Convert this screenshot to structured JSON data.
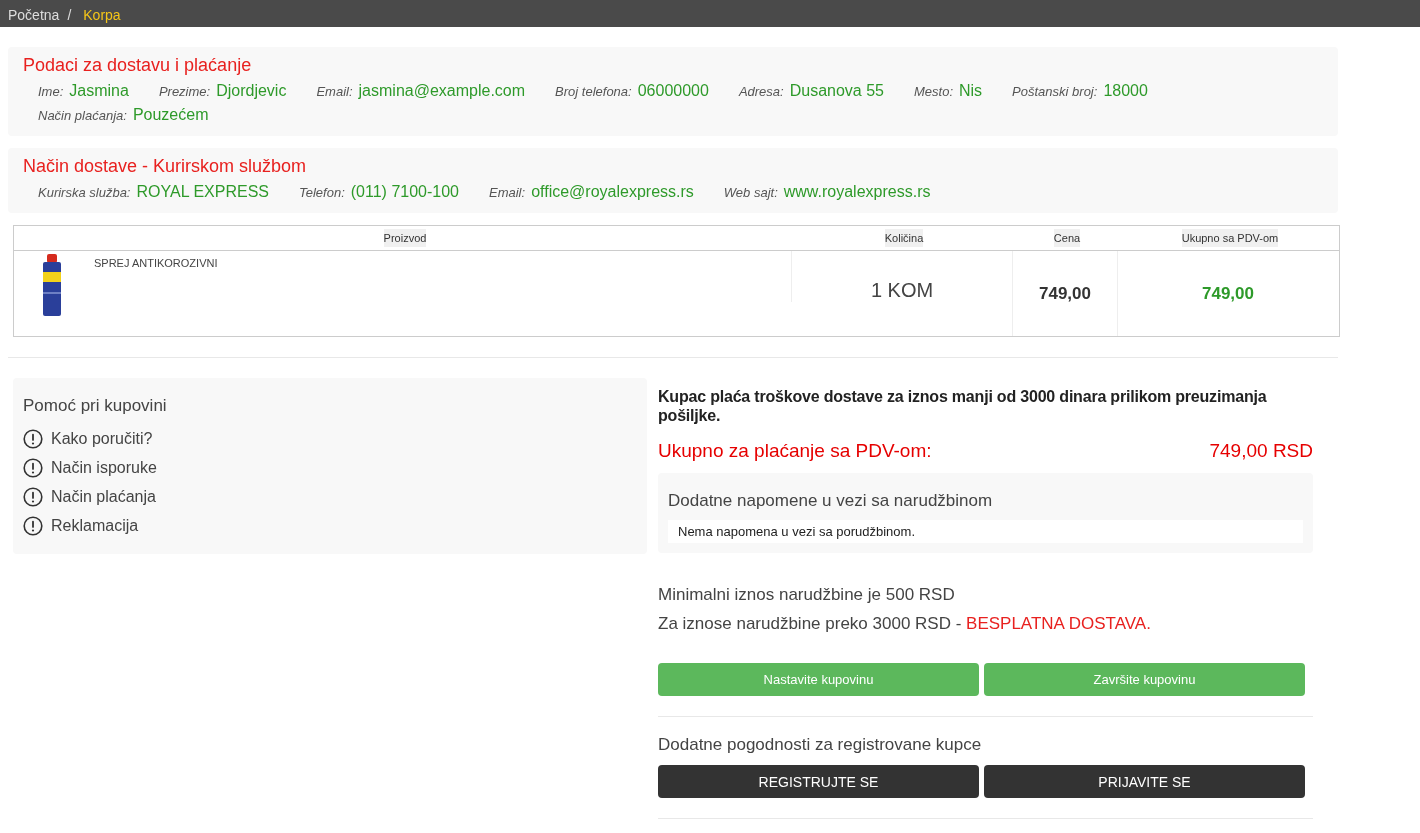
{
  "breadcrumb": [
    {
      "label": "Početna",
      "selected": false
    },
    {
      "label": "Korpa",
      "selected": true
    }
  ],
  "breadcrumb_separator": "/",
  "delivery_data": {
    "title": "Podaci za dostavu i plaćanje",
    "fields": [
      {
        "label": "Ime:",
        "value": "Jasmina"
      },
      {
        "label": "Prezime:",
        "value": "Djordjevic"
      },
      {
        "label": "Email:",
        "value": "jasmina@example.com"
      },
      {
        "label": "Broj telefona:",
        "value": "06000000"
      },
      {
        "label": "Adresa:",
        "value": "Dusanova 55"
      },
      {
        "label": "Mesto:",
        "value": "Nis"
      },
      {
        "label": "Poštanski broj:",
        "value": "18000"
      },
      {
        "label": "Način plaćanja:",
        "value": "Pouzećem"
      }
    ]
  },
  "shipping": {
    "title": "Način dostave - Kurirskom službom",
    "fields": [
      {
        "label": "Kurirska služba:",
        "value": "ROYAL EXPRESS"
      },
      {
        "label": "Telefon:",
        "value": "(011) 7100-100"
      },
      {
        "label": "Email:",
        "value": "office@royalexpress.rs"
      },
      {
        "label": "Web sajt:",
        "value": "www.royalexpress.rs"
      }
    ]
  },
  "table": {
    "columns": [
      "Proizvod",
      "Količina",
      "Cena",
      "Ukupno sa PDV-om"
    ],
    "rows": [
      {
        "product": "SPREJ ANTIKOROZIVNI",
        "quantity": "1 KOM",
        "price": "749,00",
        "total": "749,00"
      }
    ]
  },
  "help": {
    "title": "Pomoć pri kupovini",
    "items": [
      "Kako poručiti?",
      "Način isporuke",
      "Način plaćanja",
      "Reklamacija"
    ]
  },
  "summary": {
    "shipping_note": "Kupac plaća troškove dostave za iznos manji od 3000 dinara prilikom preuzimanja pošiljke.",
    "total_label": "Ukupno za plaćanje sa PDV-om:",
    "total_value": "749,00 RSD",
    "notes_title": "Dodatne napomene u vezi sa narudžbinom",
    "notes_text": "Nema napomena u vezi sa porudžbinom.",
    "minimum": "Minimalni iznos narudžbine je 500 RSD",
    "free_delivery": {
      "text": "Za iznose narudžbine preko 3000 RSD - ",
      "highlight": "BESPLATNA DOSTAVA."
    },
    "cart_buttons": [
      "Nastavite kupovinu",
      "Završite kupovinu"
    ],
    "register_title": "Dodatne pogodnosti za registrovane kupce",
    "account_buttons": [
      "REGISTRUJTE SE",
      "PRIJAVITE SE"
    ]
  }
}
